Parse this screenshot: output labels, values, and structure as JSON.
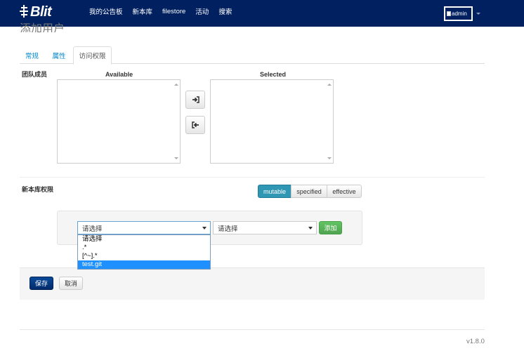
{
  "app": {
    "logo_text": "Blit",
    "nav": [
      "我的公告板",
      "新本库",
      "filestore",
      "活动",
      "搜索"
    ],
    "user": {
      "avatar_alt": "admin"
    }
  },
  "page": {
    "title": "添加用户"
  },
  "tabs": [
    {
      "label": "常规",
      "active": false
    },
    {
      "label": "属性",
      "active": false
    },
    {
      "label": "访问权限",
      "active": true
    }
  ],
  "team_members": {
    "label": "团队成员",
    "available_label": "Available",
    "selected_label": "Selected"
  },
  "repo_permissions": {
    "label": "新本库权限",
    "modes": [
      {
        "label": "mutable",
        "active": true
      },
      {
        "label": "specified",
        "active": false
      },
      {
        "label": "effective",
        "active": false
      }
    ],
    "repo_select": {
      "value": "请选择",
      "options": [
        "请选择",
        ".*",
        "[^~].*",
        "test.git"
      ],
      "highlighted_option": "test.git"
    },
    "permission_select": {
      "value": "请选择"
    },
    "add_label": "添加"
  },
  "form_actions": {
    "save_label": "保存",
    "cancel_label": "取消"
  },
  "footer": {
    "version": "v1.8.0"
  },
  "colors": {
    "navbar": "#002060",
    "accent_info": "#2f96b4",
    "success": "#51a351",
    "primary": "#002a6a"
  }
}
